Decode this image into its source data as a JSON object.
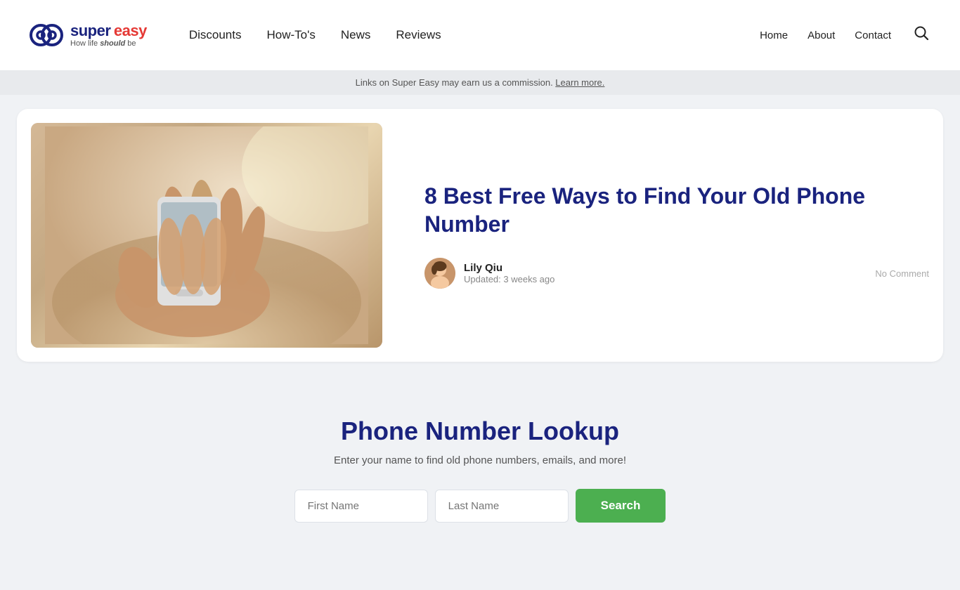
{
  "header": {
    "logo": {
      "super": "super",
      "easy": "easy",
      "tagline_prefix": "How life ",
      "tagline_bold": "should",
      "tagline_suffix": " be"
    },
    "nav": {
      "items": [
        {
          "label": "Discounts",
          "href": "#"
        },
        {
          "label": "How-To's",
          "href": "#"
        },
        {
          "label": "News",
          "href": "#"
        },
        {
          "label": "Reviews",
          "href": "#"
        }
      ]
    },
    "right_nav": {
      "items": [
        {
          "label": "Home",
          "href": "#"
        },
        {
          "label": "About",
          "href": "#"
        },
        {
          "label": "Contact",
          "href": "#"
        }
      ]
    }
  },
  "commission_bar": {
    "text_prefix": "Links on Super Easy may earn us a commission. ",
    "link_text": "Learn more."
  },
  "article": {
    "title": "8 Best Free Ways to Find Your Old Phone Number",
    "author_name": "Lily Qiu",
    "updated": "Updated: 3 weeks ago",
    "no_comment": "No Comment"
  },
  "lookup": {
    "title": "Phone Number Lookup",
    "subtitle": "Enter your name to find old phone numbers, emails, and more!",
    "first_name_placeholder": "First Name",
    "last_name_placeholder": "Last Name",
    "search_label": "Search"
  }
}
